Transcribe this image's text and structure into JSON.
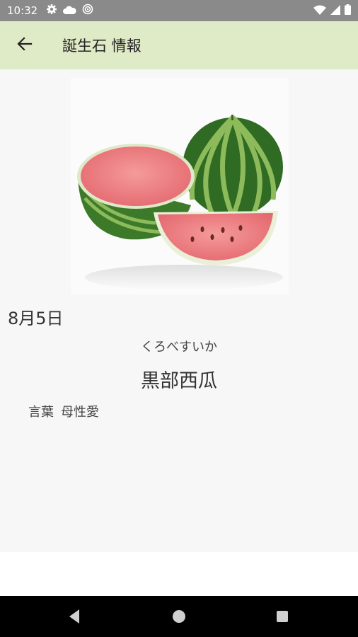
{
  "status_bar": {
    "time": "10:32",
    "left_icons": [
      "settings-icon",
      "cloud-icon",
      "sync-icon"
    ],
    "right_icons": [
      "wifi-icon",
      "cell-signal-icon",
      "battery-icon"
    ]
  },
  "app_bar": {
    "back_icon": "arrow-back-icon",
    "title": "誕生石 情報"
  },
  "detail": {
    "image": "watermelon-photo",
    "date": "8月5日",
    "reading": "くろべすいか",
    "name": "黒部西瓜",
    "meaning_label": "言葉",
    "meaning_value": "母性愛"
  },
  "nav_bar": {
    "buttons": [
      "back-triangle-icon",
      "home-circle-icon",
      "recents-square-icon"
    ]
  },
  "colors": {
    "status_bar": "#8a8a8a",
    "app_bar": "#dfeac6",
    "content_bg": "#f7f7f7",
    "nav_bar": "#000000"
  }
}
